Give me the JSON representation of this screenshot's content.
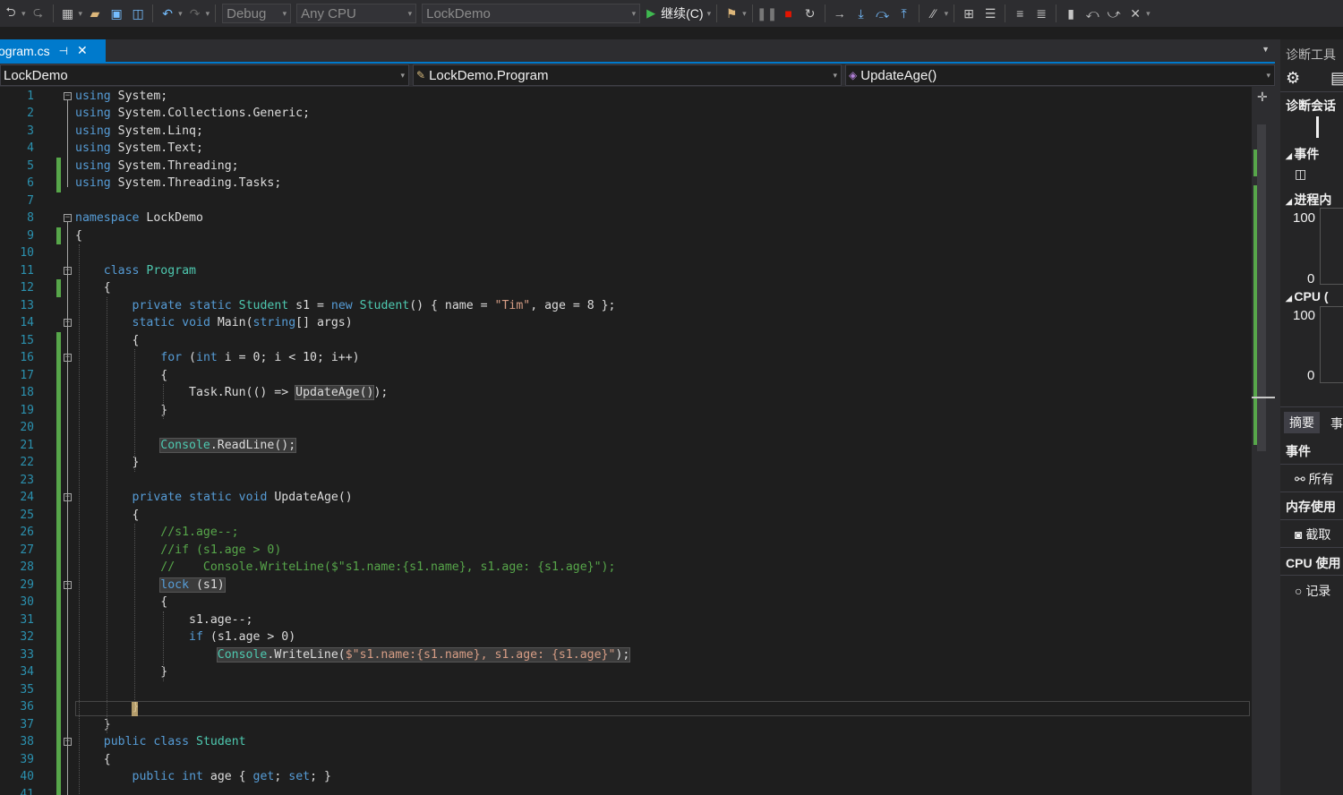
{
  "toolbar": {
    "config": "Debug",
    "platform": "Any CPU",
    "project": "LockDemo",
    "continue_label": "继续(C)"
  },
  "tab": {
    "filename": "ogram.cs",
    "pin": "⊣",
    "close": "✕"
  },
  "navbar": {
    "project": "LockDemo",
    "class": "LockDemo.Program",
    "member": "UpdateAge()"
  },
  "editor": {
    "line_numbers": [
      "1",
      "2",
      "3",
      "4",
      "5",
      "6",
      "7",
      "8",
      "9",
      "10",
      "11",
      "12",
      "13",
      "14",
      "15",
      "16",
      "17",
      "18",
      "19",
      "20",
      "21",
      "22",
      "23",
      "24",
      "25",
      "26",
      "27",
      "28",
      "29",
      "30",
      "31",
      "32",
      "33",
      "34",
      "35",
      "36",
      "37",
      "38",
      "39",
      "40",
      "41"
    ],
    "lines": [
      "using System;",
      "using System.Collections.Generic;",
      "using System.Linq;",
      "using System.Text;",
      "using System.Threading;",
      "using System.Threading.Tasks;",
      "",
      "namespace LockDemo",
      "{",
      "",
      "    class Program",
      "    {",
      "        private static Student s1 = new Student() { name = \"Tim\", age = 8 };",
      "        static void Main(string[] args)",
      "        {",
      "            for (int i = 0; i < 10; i++)",
      "            {",
      "                Task.Run(() => UpdateAge());",
      "            }",
      "",
      "            Console.ReadLine();",
      "        }",
      "",
      "        private static void UpdateAge()",
      "        {",
      "            //s1.age--;",
      "            //if (s1.age > 0)",
      "            //    Console.WriteLine($\"s1.name:{s1.name}, s1.age: {s1.age}\");",
      "            lock (s1)",
      "            {",
      "                s1.age--;",
      "                if (s1.age > 0)",
      "                    Console.WriteLine($\"s1.name:{s1.name}, s1.age: {s1.age}\");",
      "            }",
      "",
      "        }",
      "    }",
      "    public class Student",
      "    {",
      "        public int age { get; set; }",
      ""
    ]
  },
  "diagnostics": {
    "title": "诊断工具",
    "session": "诊断会话",
    "events": "事件",
    "process_memory": "进程内",
    "mem_max": "100",
    "mem_min": "0",
    "cpu": "CPU (",
    "cpu_max": "100",
    "cpu_min": "0",
    "tab_summary": "摘要",
    "tab_events": "事",
    "events_header": "事件",
    "all_events": "所有",
    "memory_usage": "内存使用",
    "snapshot": "截取",
    "cpu_usage": "CPU 使用",
    "record": "记录"
  },
  "colors": {
    "keyword": "#569cd6",
    "type": "#4ec9b0",
    "string": "#d69d85",
    "comment": "#57a64a",
    "line_number": "#2b91af",
    "accent": "#007acc"
  }
}
